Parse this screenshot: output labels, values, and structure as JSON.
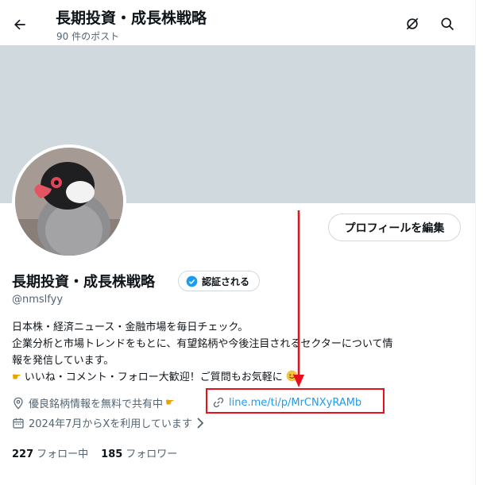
{
  "header": {
    "title": "長期投資・成長株戦略",
    "post_count": "90 件のポスト"
  },
  "profile": {
    "name": "長期投資・成長株戦略",
    "verify_label": "認証される",
    "handle": "@nmslfyy",
    "edit_button": "プロフィールを編集",
    "bio": [
      "日本株・経済ニュース・金融市場を毎日チェック。",
      "企業分析と市場トレンドをもとに、有望銘柄や今後注目されるセクターについて情",
      "報を発信しています。",
      "いいね・コメント・フォロー大歓迎！ご質問もお気軽に"
    ],
    "location": "優良銘柄情報を無料で共有中",
    "link": "line.me/ti/p/MrCNXyRAMb",
    "joined": "2024年7月からXを利用しています",
    "following_count": "227",
    "following_label": "フォロー中",
    "followers_count": "185",
    "followers_label": "フォロワー"
  },
  "colors": {
    "accent": "#1d9bf0",
    "banner": "#cfd9de",
    "annotation": "#e8101a"
  },
  "icons": [
    "back-arrow-icon",
    "grok-icon",
    "search-icon",
    "verified-badge-icon",
    "location-icon",
    "link-icon",
    "calendar-icon",
    "chevron-right-icon",
    "pointing-hand-icon",
    "smile-emoji-icon"
  ]
}
